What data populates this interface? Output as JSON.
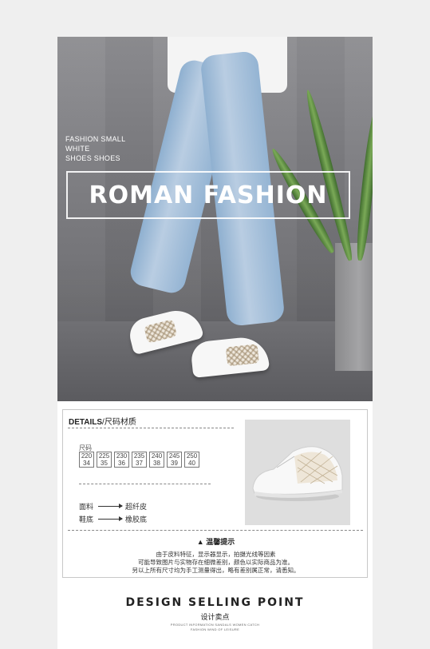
{
  "hero": {
    "subtitle_lines": [
      "FASHION SMALL",
      "WHITE",
      "SHOES SHOES"
    ],
    "title": "ROMAN FASHION"
  },
  "details": {
    "heading_bold": "DETAILS",
    "heading_rest": "/尺码材质",
    "size_label": "尺码",
    "sizes": [
      {
        "mm": "220",
        "eu": "34"
      },
      {
        "mm": "225",
        "eu": "35"
      },
      {
        "mm": "230",
        "eu": "36"
      },
      {
        "mm": "235",
        "eu": "37"
      },
      {
        "mm": "240",
        "eu": "38"
      },
      {
        "mm": "245",
        "eu": "39"
      },
      {
        "mm": "250",
        "eu": "40"
      }
    ],
    "materials": [
      {
        "label": "面料",
        "value": "超纤皮"
      },
      {
        "label": "鞋底",
        "value": "橡胶底"
      }
    ],
    "tip_title": "温馨提示",
    "tip_lines": [
      "由于皮料特征，显示器显示，拍摄光线等因素",
      "可能导致图片与实物存在细微差别，颜色以实际商品为准。",
      "另以上所有尺寸均为手工测量得出，略有差别属正常，请悉知。"
    ]
  },
  "selling_point": {
    "title": "DESIGN SELLING POINT",
    "subtitle_cn": "设计卖点",
    "small_line_1": "PRODUCT INFORMATION SANDALS WOMEN CATCH",
    "small_line_2": "FASHION WIND OF LEISURE"
  },
  "colors": {
    "page_bg": "#efefef",
    "panel_bg": "#ffffff",
    "jeans": "#a9c1da",
    "text_dark": "#222222"
  }
}
